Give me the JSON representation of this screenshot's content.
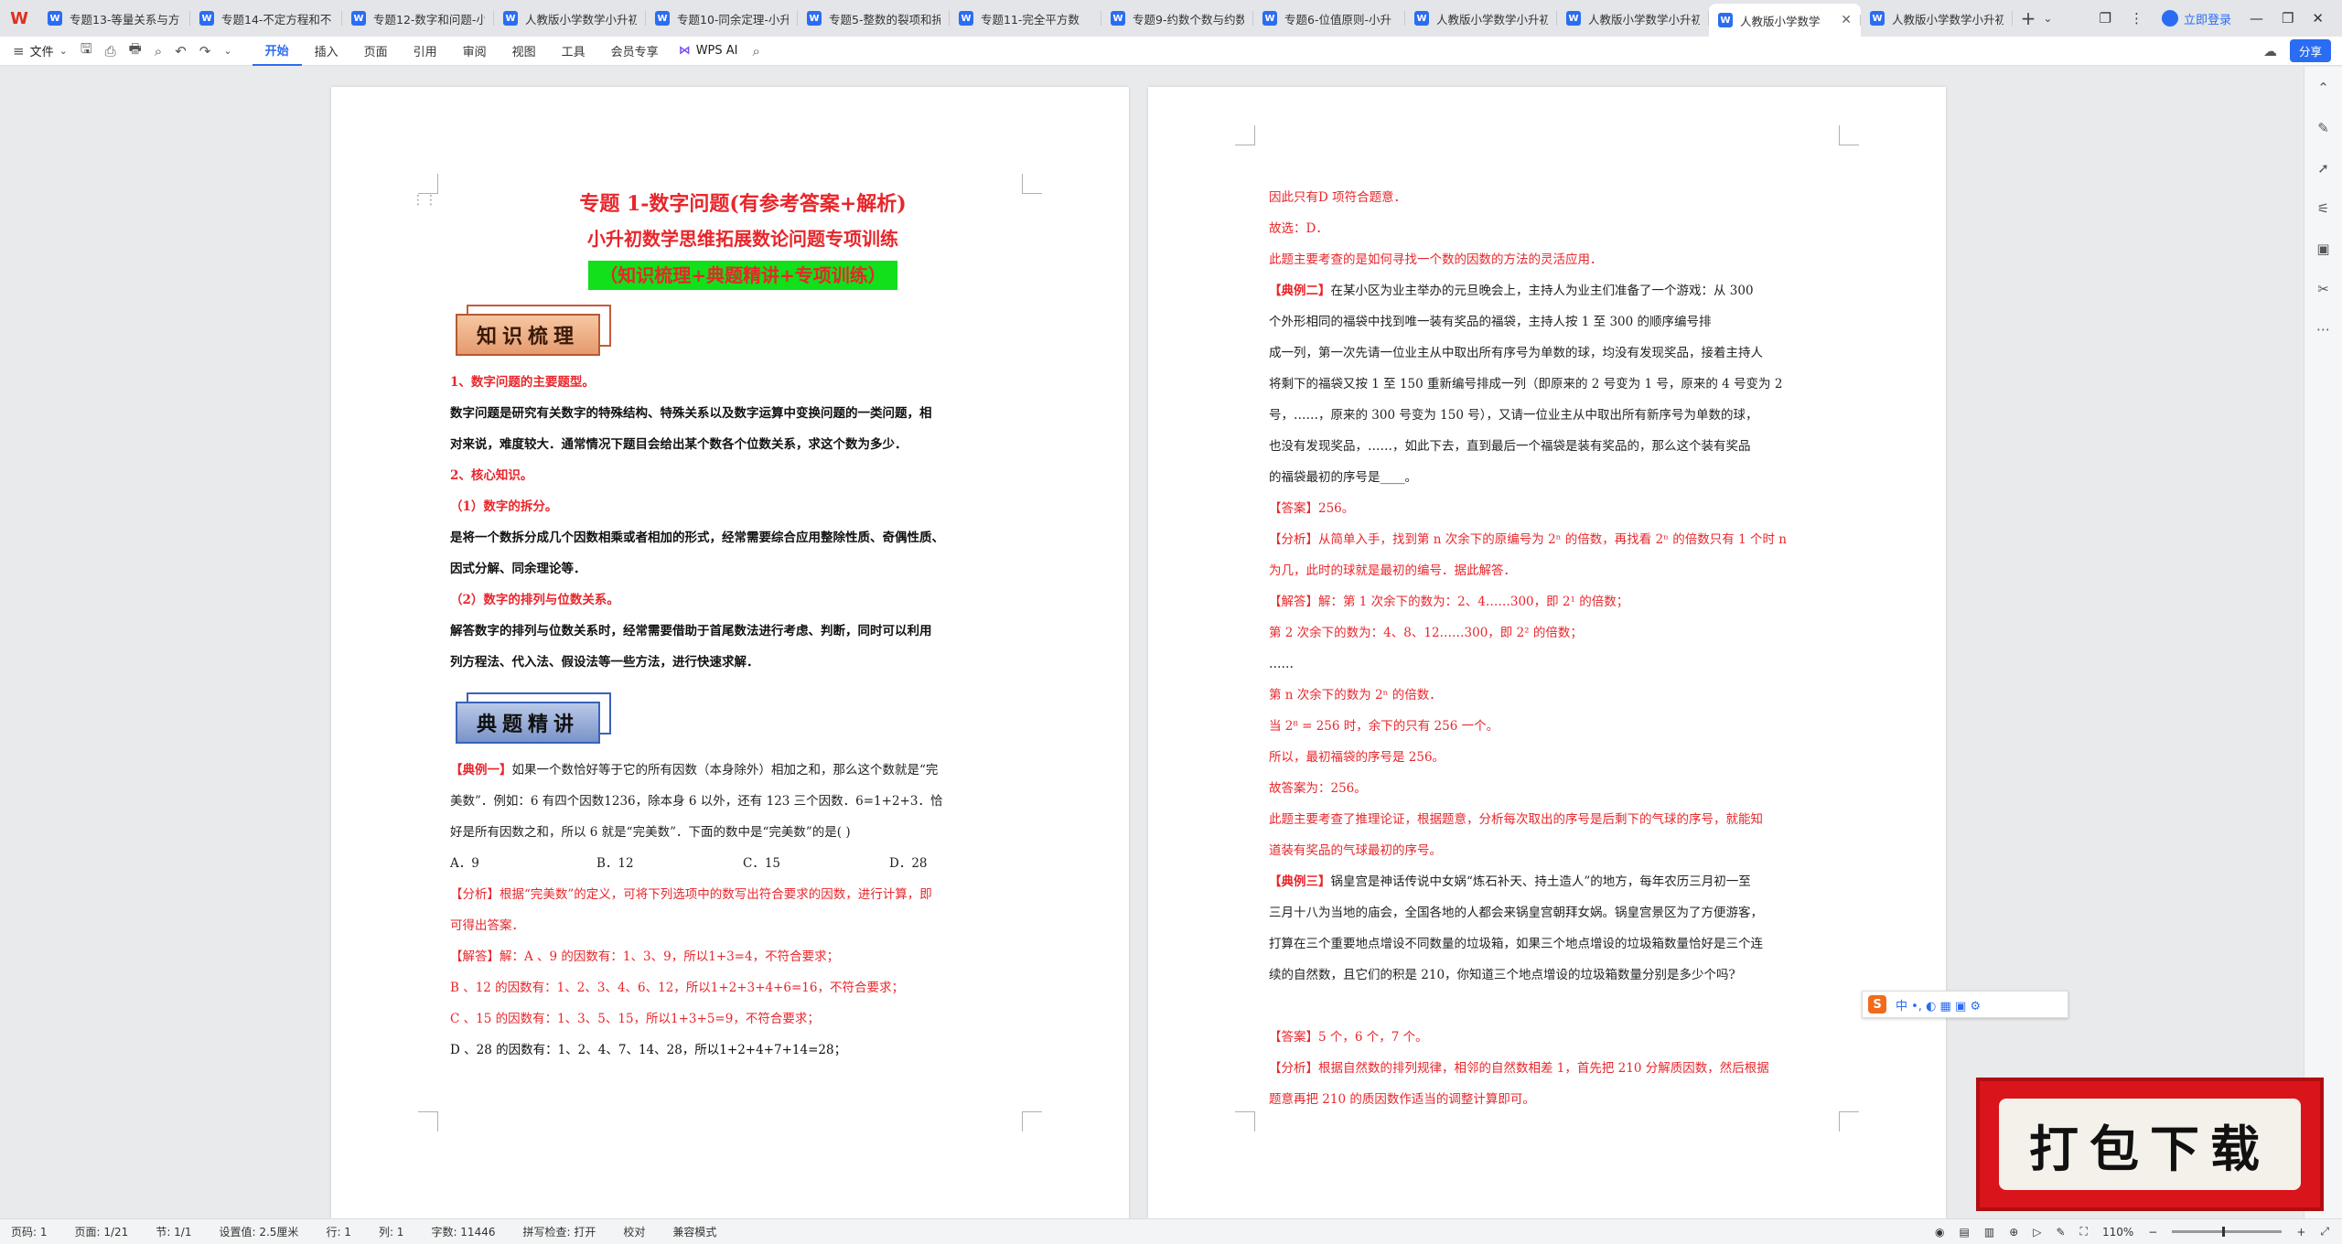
{
  "tabs": [
    {
      "label": "专题13-等量关系与方",
      "active": false
    },
    {
      "label": "专题14-不定方程和不",
      "active": false
    },
    {
      "label": "专题12-数字和问题-小",
      "active": false
    },
    {
      "label": "人教版小学数学小升初",
      "active": false
    },
    {
      "label": "专题10-同余定理-小升",
      "active": false
    },
    {
      "label": "专题5-整数的裂项和拆",
      "active": false
    },
    {
      "label": "专题11-完全平方数",
      "active": false
    },
    {
      "label": "专题9-约数个数与约数",
      "active": false
    },
    {
      "label": "专题6-位值原则-小升",
      "active": false
    },
    {
      "label": "人教版小学数学小升初",
      "active": false
    },
    {
      "label": "人教版小学数学小升初",
      "active": false
    },
    {
      "label": "人教版小学数学",
      "active": true
    },
    {
      "label": "人教版小学数学小升初",
      "active": false
    }
  ],
  "header": {
    "login": "立即登录"
  },
  "ribbon": {
    "file_menu": "文件",
    "tabs": [
      "开始",
      "插入",
      "页面",
      "引用",
      "审阅",
      "视图",
      "工具",
      "会员专享"
    ],
    "wps_ai": "WPS AI",
    "share": "分享"
  },
  "page1": {
    "title1": "专题 1-数字问题(有参考答案+解析)",
    "title2": "小升初数学思维拓展数论问题专项训练",
    "title3": "（知识梳理+典题精讲+专项训练）",
    "banner1": "知识梳理",
    "s1_heading": "1、数字问题的主要题型。",
    "s1_l1": "数字问题是研究有关数字的特殊结构、特殊关系以及数字运算中变换问题的一类问题，相",
    "s1_l2": "对来说，难度较大．通常情况下题目会给出某个数各个位数关系，求这个数为多少．",
    "s2_heading": "2、核心知识。",
    "s2_sub1": "（1）数字的拆分。",
    "s2_l1": "是将一个数拆分成几个因数相乘或者相加的形式，经常需要综合应用整除性质、奇偶性质、",
    "s2_l2": "因式分解、同余理论等．",
    "s2_sub2": "（2）数字的排列与位数关系。",
    "s2_l3": "解答数字的排列与位数关系时，经常需要借助于首尾数法进行考虑、判断，同时可以利用",
    "s2_l4": "列方程法、代入法、假设法等一些方法，进行快速求解．",
    "banner2": "典题精讲",
    "ex1_tag": "【典例一】",
    "ex1_l1": "如果一个数恰好等于它的所有因数（本身除外）相加之和，那么这个数就是“完",
    "ex1_l2": "美数”．例如：6 有四个因数1236，除本身 6 以外，还有 123 三个因数．6=1+2+3．恰",
    "ex1_l3": "好是所有因数之和，所以 6 就是“完美数”．下面的数中是“完美数”的是(      )",
    "options": [
      "A．9",
      "B．12",
      "C．15",
      "D．28"
    ],
    "an1_l1": "【分析】根据“完美数”的定义，可将下列选项中的数写出符合要求的因数，进行计算，即",
    "an1_l2": "可得出答案．",
    "sol_l1": "【解答】解：A 、9 的因数有：1、3、9，所以1+3=4，不符合要求；",
    "sol_l2": "B 、12 的因数有：1、2、3、4、6、12，所以1+2+3+4+6=16，不符合要求；",
    "sol_l3": "C 、15 的因数有：1、3、5、15，所以1+3+5=9，不符合要求；",
    "sol_l4": "D 、28 的因数有：1、2、4、7、14、28，所以1+2+4+7+14=28；"
  },
  "page2": {
    "l1": "因此只有D 项符合题意．",
    "l2": "故选：D．",
    "l3": "此题主要考查的是如何寻找一个数的因数的方法的灵活应用．",
    "ex2_tag": "【典例二】",
    "ex2_l1": "在某小区为业主举办的元旦晚会上，主持人为业主们准备了一个游戏：从 300",
    "ex2_l2": "个外形相同的福袋中找到唯一装有奖品的福袋，主持人按 1 至 300 的顺序编号排",
    "ex2_l3": "成一列，第一次先请一位业主从中取出所有序号为单数的球，均没有发现奖品，接着主持人",
    "ex2_l4": "将剩下的福袋又按 1 至 150 重新编号排成一列（即原来的 2 号变为 1 号，原来的 4 号变为 2",
    "ex2_l5": "号，……，原来的 300 号变为 150 号），又请一位业主从中取出所有新序号为单数的球，",
    "ex2_l6": "也没有发现奖品，……，如此下去，直到最后一个福袋是装有奖品的，那么这个装有奖品",
    "ex2_l7": "的福袋最初的序号是____。",
    "ans2": "【答案】256。",
    "an2_l1": "【分析】从简单入手，找到第 n 次余下的原编号为 2ⁿ 的倍数，再找看 2ⁿ 的倍数只有 1 个时 n",
    "an2_l2": "为几，此时的球就是最初的编号．据此解答．",
    "sol2_l1": "【解答】解：第 1 次余下的数为：2、4……300，即 2¹ 的倍数；",
    "sol2_l2": "第 2 次余下的数为：4、8、12……300，即 2² 的倍数；",
    "sol2_l3": "……",
    "sol2_l4": "第 n 次余下的数为 2ⁿ 的倍数．",
    "sol2_l5": "当 2⁸ = 256 时，余下的只有 256 一个。",
    "sol2_l6": "所以，最初福袋的序号是 256。",
    "sol2_l7": "故答案为：256。",
    "sol2_l8": "此题主要考查了推理论证，根据题意，分析每次取出的序号是后剩下的气球的序号，就能知",
    "sol2_l9": "道装有奖品的气球最初的序号。",
    "ex3_tag": "【典例三】",
    "ex3_l1": "锅皇宫是神话传说中女娲“炼石补天、持土造人”的地方，每年农历三月初一至",
    "ex3_l2": "三月十八为当地的庙会，全国各地的人都会来锅皇宫朝拜女娲。锅皇宫景区为了方便游客，",
    "ex3_l3": "打算在三个重要地点增设不同数量的垃圾箱，如果三个地点增设的垃圾箱数量恰好是三个连",
    "ex3_l4": "续的自然数，且它们的积是 210，你知道三个地点增设的垃圾箱数量分别是多少个吗?",
    "ans3": "【答案】5 个，6 个，7 个。",
    "an3_l1": "【分析】根据自然数的排列规律，相邻的自然数相差 1，首先把 210 分解质因数，然后根据",
    "an3_l2": "题意再把 210 的质因数作适当的调整计算即可。"
  },
  "ime": {
    "s": "S",
    "text": "中 •, ◐ ▦ ▣ ⚙"
  },
  "download_ad": "打包下载",
  "status": {
    "page": "页码: 1",
    "pages": "页面: 1/21",
    "section": "节: 1/1",
    "setting": "设置值: 2.5厘米",
    "row": "行: 1",
    "col": "列: 1",
    "words": "字数: 11446",
    "spell": "拼写检查: 打开",
    "proof": "校对",
    "compat": "兼容模式",
    "zoom": "110%"
  }
}
